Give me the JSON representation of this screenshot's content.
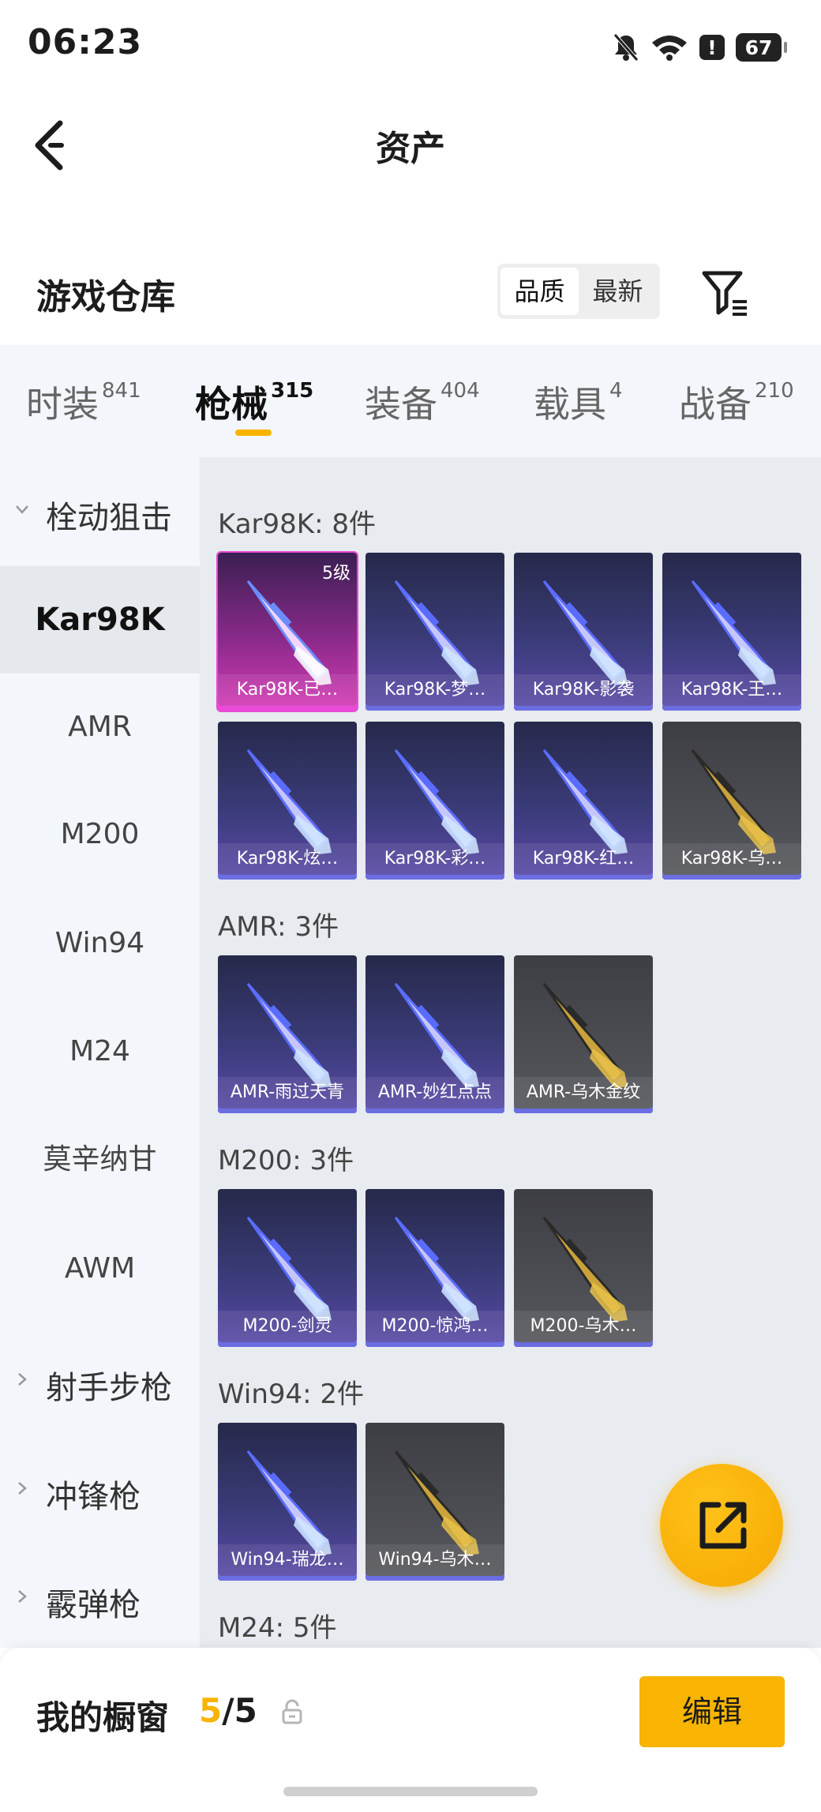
{
  "status_bar": {
    "time": "06:23",
    "battery": "67",
    "icons": [
      "bell-off-icon",
      "wifi-icon",
      "alert-icon",
      "battery-icon"
    ]
  },
  "header": {
    "title": "资产"
  },
  "section": {
    "title": "游戏仓库",
    "sort_options": [
      "品质",
      "最新"
    ],
    "sort_selected": "品质"
  },
  "tabs": [
    {
      "label": "时装",
      "count": "841"
    },
    {
      "label": "枪械",
      "count": "315"
    },
    {
      "label": "装备",
      "count": "404"
    },
    {
      "label": "载具",
      "count": "4"
    },
    {
      "label": "战备",
      "count": "210"
    }
  ],
  "active_tab": "枪械",
  "sidebar": {
    "groups": [
      {
        "label": "栓动狙击",
        "expanded": true
      },
      {
        "label": "射手步枪",
        "expanded": false
      },
      {
        "label": "冲锋枪",
        "expanded": false
      },
      {
        "label": "霰弹枪",
        "expanded": false
      }
    ],
    "items": [
      "Kar98K",
      "AMR",
      "M200",
      "Win94",
      "M24",
      "莫辛纳甘",
      "AWM"
    ],
    "selected_item": "Kar98K"
  },
  "groups": [
    {
      "header": "Kar98K: 8件",
      "cards": [
        {
          "name": "Kar98K-已…",
          "level": "5级",
          "rarity": "legendary"
        },
        {
          "name": "Kar98K-梦…",
          "rarity": "epic"
        },
        {
          "name": "Kar98K-影袭",
          "rarity": "epic"
        },
        {
          "name": "Kar98K-王…",
          "rarity": "epic"
        },
        {
          "name": "Kar98K-炫…",
          "rarity": "epic"
        },
        {
          "name": "Kar98K-彩…",
          "rarity": "epic"
        },
        {
          "name": "Kar98K-红…",
          "rarity": "epic"
        },
        {
          "name": "Kar98K-乌…",
          "rarity": "rare"
        }
      ]
    },
    {
      "header": "AMR: 3件",
      "cards": [
        {
          "name": "AMR-雨过天青",
          "rarity": "epic"
        },
        {
          "name": "AMR-妙红点点",
          "rarity": "epic"
        },
        {
          "name": "AMR-乌木金纹",
          "rarity": "rare"
        }
      ]
    },
    {
      "header": "M200: 3件",
      "cards": [
        {
          "name": "M200-剑灵",
          "rarity": "epic"
        },
        {
          "name": "M200-惊鸿…",
          "rarity": "epic"
        },
        {
          "name": "M200-乌木…",
          "rarity": "rare"
        }
      ]
    },
    {
      "header": "Win94: 2件",
      "cards": [
        {
          "name": "Win94-瑞龙…",
          "rarity": "epic"
        },
        {
          "name": "Win94-乌木…",
          "rarity": "rare"
        }
      ]
    },
    {
      "header": "M24: 5件",
      "cards": []
    }
  ],
  "bottom_bar": {
    "label": "我的橱窗",
    "count_current": "5",
    "count_sep": "/",
    "count_total": "5",
    "edit_label": "编辑"
  },
  "colors": {
    "accent": "#f8b400",
    "epic_bg": "#3a3b78",
    "legendary_bg": "#d73cb6",
    "rare_bg": "#57585d"
  }
}
